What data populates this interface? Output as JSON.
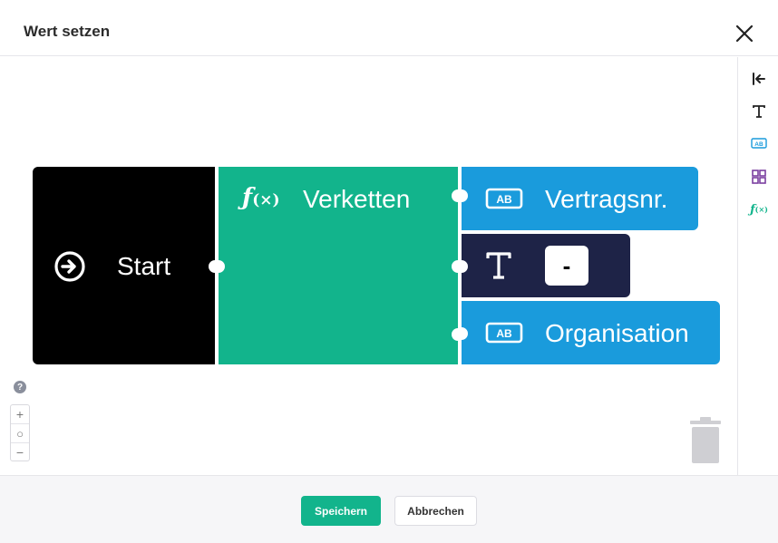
{
  "dialog": {
    "title": "Wert setzen",
    "close_icon": "close-icon"
  },
  "blocks": {
    "start": {
      "label": "Start",
      "icon": "arrow-circle-right-icon",
      "color": "#000000"
    },
    "concat": {
      "label": "Verketten",
      "icon": "function-icon",
      "color": "#12b48c"
    },
    "field1": {
      "label": "Vertragsnr.",
      "icon": "text-field-icon",
      "color": "#1a9bdc"
    },
    "text": {
      "value": "-",
      "icon": "text-icon",
      "color": "#1e2347"
    },
    "field2": {
      "label": "Organisation",
      "icon": "text-field-icon",
      "color": "#1a9bdc"
    }
  },
  "toolbox": {
    "items": [
      "collapse-icon",
      "text-icon",
      "text-field-icon",
      "grid-icon",
      "function-icon"
    ]
  },
  "zoom": {
    "help": "?",
    "in": "+",
    "reset": "○",
    "out": "−"
  },
  "footer": {
    "save_label": "Speichern",
    "cancel_label": "Abbrechen"
  },
  "colors": {
    "accent": "#12b48c",
    "field": "#1a9bdc",
    "text_block": "#1e2347"
  }
}
